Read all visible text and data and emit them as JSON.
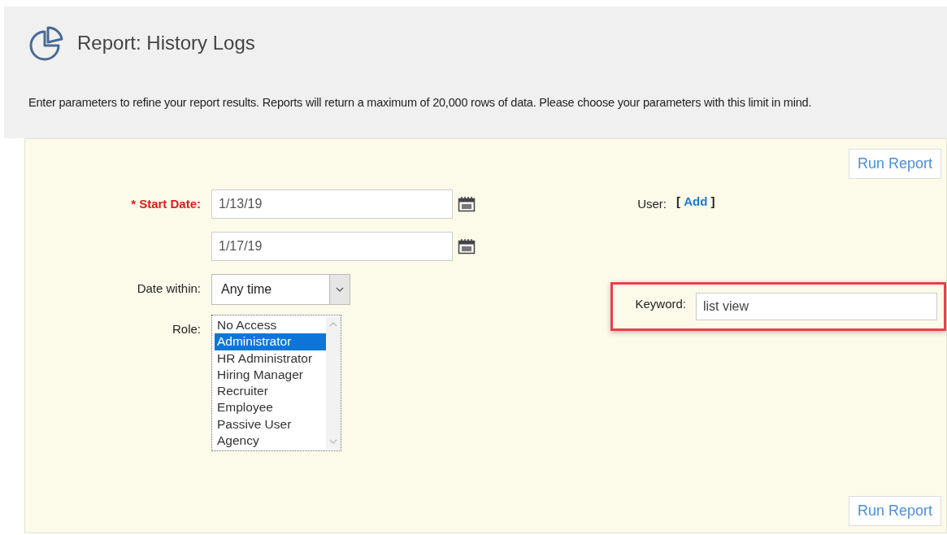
{
  "header": {
    "title": "Report: History Logs"
  },
  "intro": "Enter parameters to refine your report results. Reports will return a maximum of 20,000 rows of data. Please choose your parameters with this limit in mind.",
  "buttons": {
    "top": "Run Report",
    "bottom": "Run Report"
  },
  "start_date": {
    "required_mark": "*",
    "label": "Start Date:",
    "from": "1/13/19",
    "to": "1/17/19"
  },
  "date_within": {
    "label": "Date within:",
    "value": "Any time"
  },
  "role": {
    "label": "Role:",
    "options": [
      {
        "label": "No Access",
        "selected": false
      },
      {
        "label": "Administrator",
        "selected": true
      },
      {
        "label": "HR Administrator",
        "selected": false
      },
      {
        "label": "Hiring Manager",
        "selected": false
      },
      {
        "label": "Recruiter",
        "selected": false
      },
      {
        "label": "Employee",
        "selected": false
      },
      {
        "label": "Passive User",
        "selected": false
      },
      {
        "label": "Agency",
        "selected": false
      }
    ]
  },
  "user": {
    "label": "User:",
    "open_bracket": "[",
    "link": "Add",
    "close_bracket": "]"
  },
  "keyword": {
    "label": "Keyword:",
    "value": "list view",
    "highlighted": true
  }
}
